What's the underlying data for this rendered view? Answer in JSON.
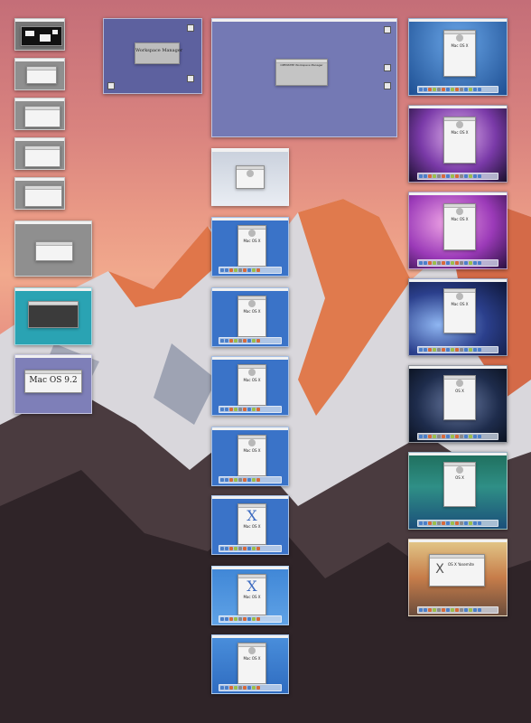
{
  "desktop": {
    "wallpaper": "mountain-sunset-wallpaper"
  },
  "windows": {
    "nextstep": {
      "title": "Workspace Manager"
    },
    "openstep": {
      "title": "OPENSTEP Workspace Manager"
    },
    "macos92": {
      "title": "Mac OS 9.2"
    },
    "beta_aqua": {
      "title": "Mac OS X"
    },
    "aqua_1": {
      "title": "Mac OS X"
    },
    "aqua_2": {
      "title": "Mac OS X"
    },
    "aqua_3": {
      "title": "Mac OS X"
    },
    "aqua_4": {
      "title": "Mac OS X"
    },
    "aqua_5": {
      "title": "Mac OS X",
      "mark": "X"
    },
    "aqua_6": {
      "title": "Mac OS X",
      "mark": "X"
    },
    "aqua_7": {
      "title": "Mac OS X"
    },
    "leopard": {
      "title": "Mac OS X"
    },
    "snow_leopard": {
      "title": "Mac OS X"
    },
    "snow_leopard_2": {
      "title": "Mac OS X"
    },
    "lion": {
      "title": "Mac OS X"
    },
    "mountain_lion": {
      "title": "OS X"
    },
    "mavericks": {
      "title": "OS X"
    },
    "yosemite": {
      "title": "OS X Yosemite",
      "mark": "X"
    }
  },
  "colors": {
    "sky_top": "#c46e78",
    "sky_mid": "#f1a98d",
    "nextstep_bg": "#5d619f",
    "classic_gray": "#8f8f8f",
    "aqua_blue": "#3a73c8"
  }
}
